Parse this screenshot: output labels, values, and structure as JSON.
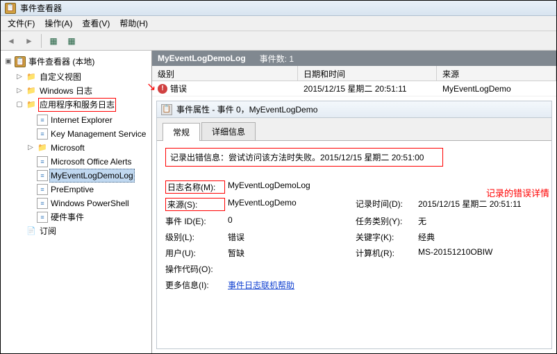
{
  "window": {
    "title": "事件查看器"
  },
  "menu": {
    "file": "文件(F)",
    "action": "操作(A)",
    "view": "查看(V)",
    "help": "帮助(H)"
  },
  "tree": {
    "root": "事件查看器 (本地)",
    "custom_views": "自定义视图",
    "windows_logs": "Windows 日志",
    "app_service_logs": "应用程序和服务日志",
    "items": {
      "ie": "Internet Explorer",
      "kms": "Key Management Service",
      "ms": "Microsoft",
      "moa": "Microsoft Office Alerts",
      "demo": "MyEventLogDemoLog",
      "pre": "PreEmptive",
      "wps": "Windows PowerShell",
      "hw": "硬件事件"
    },
    "subscriptions": "订阅"
  },
  "header": {
    "name": "MyEventLogDemoLog",
    "count_label": "事件数:",
    "count": "1"
  },
  "grid": {
    "col_level": "级别",
    "col_datetime": "日期和时间",
    "col_source": "来源",
    "rows": [
      {
        "level": "错误",
        "datetime": "2015/12/15 星期二 20:51:11",
        "source": "MyEventLogDemo"
      }
    ]
  },
  "prop": {
    "title": "事件属性 - 事件 0，MyEventLogDemo",
    "tab_general": "常规",
    "tab_details": "详细信息",
    "message": "记录出错信息：尝试访问该方法时失败。2015/12/15 星期二 20:51:00",
    "annotation": "记录的错误详情",
    "fields": {
      "logname_l": "日志名称(M):",
      "logname_v": "MyEventLogDemoLog",
      "source_l": "来源(S):",
      "source_v": "MyEventLogDemo",
      "logged_l": "记录时间(D):",
      "logged_v": "2015/12/15 星期二 20:51:11",
      "eventid_l": "事件 ID(E):",
      "eventid_v": "0",
      "taskcat_l": "任务类别(Y):",
      "taskcat_v": "无",
      "level_l": "级别(L):",
      "level_v": "错误",
      "keywords_l": "关键字(K):",
      "keywords_v": "经典",
      "user_l": "用户(U):",
      "user_v": "暂缺",
      "computer_l": "计算机(R):",
      "computer_v": "MS-20151210OBIW",
      "opcode_l": "操作代码(O):",
      "moreinfo_l": "更多信息(I):",
      "moreinfo_link": "事件日志联机帮助"
    }
  }
}
